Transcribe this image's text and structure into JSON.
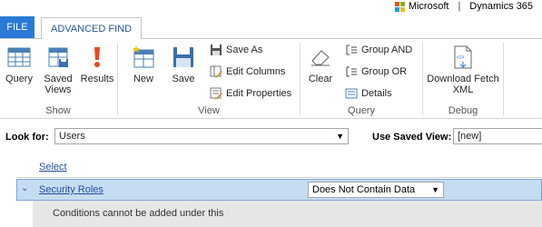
{
  "brand": {
    "company": "Microsoft",
    "product": "Dynamics 365"
  },
  "colors": {
    "accent": "#2b79d6",
    "link": "#1f4e9c",
    "selected_row": "#c6dcf2"
  },
  "tabs": [
    {
      "label": "FILE"
    },
    {
      "label": "ADVANCED FIND"
    }
  ],
  "ribbon": {
    "show": {
      "label": "Show",
      "query": "Query",
      "saved_views": "Saved\nViews",
      "results": "Results"
    },
    "view": {
      "label": "View",
      "new": "New",
      "save": "Save",
      "save_as": "Save As",
      "edit_columns": "Edit Columns",
      "edit_properties": "Edit Properties"
    },
    "query": {
      "label": "Query",
      "clear": "Clear",
      "group_and": "Group AND",
      "group_or": "Group OR",
      "details": "Details"
    },
    "debug": {
      "label": "Debug",
      "download_fetch_xml": "Download Fetch\nXML"
    }
  },
  "form": {
    "look_for_label": "Look for:",
    "look_for_value": "Users",
    "use_saved_view_label": "Use Saved View:",
    "use_saved_view_value": "[new]"
  },
  "query_rows": {
    "select_link": "Select",
    "condition": {
      "field": "Security Roles",
      "operator": "Does Not Contain Data"
    },
    "note": "Conditions cannot be added under this"
  }
}
